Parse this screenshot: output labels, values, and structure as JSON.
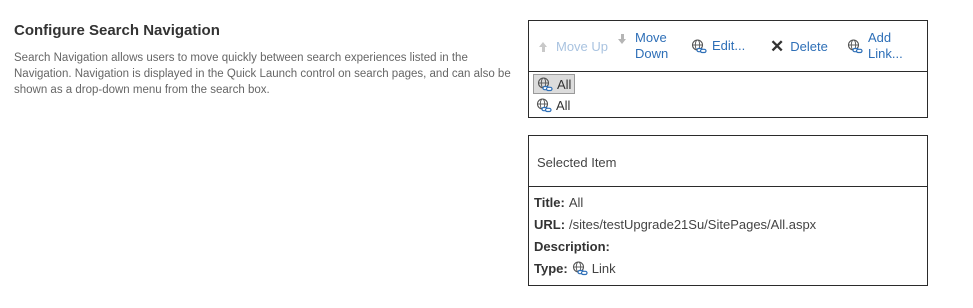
{
  "section": {
    "title": "Configure Search Navigation",
    "description": "Search Navigation allows users to move quickly between search experiences listed in the Navigation. Navigation is displayed in the Quick Launch control on search pages, and can also be shown as a drop-down menu from the search box."
  },
  "toolbar": {
    "move_up": "Move Up",
    "move_down_line1": "Move",
    "move_down_line2": "Down",
    "edit": "Edit...",
    "delete": "Delete",
    "add_link_line1": "Add",
    "add_link_line2": "Link..."
  },
  "tree": {
    "items": [
      {
        "label": "All",
        "selected": true
      },
      {
        "label": "All",
        "selected": false
      }
    ]
  },
  "selected_item": {
    "header": "Selected Item",
    "title_key": "Title:",
    "title_value": "All",
    "url_key": "URL:",
    "url_value": "/sites/testUpgrade21Su/SitePages/All.aspx",
    "description_key": "Description:",
    "description_value": "",
    "type_key": "Type:",
    "type_value": "Link"
  },
  "icons": {
    "move_up": "arrow-up-icon",
    "move_down": "arrow-down-icon",
    "edit": "link-edit-icon",
    "delete": "close-icon",
    "add_link": "add-link-icon",
    "node": "link-node-icon"
  },
  "colors": {
    "link": "#2e6fb7",
    "disabled": "#a9c3e0",
    "border": "#2b2b2b",
    "selected_bg": "#dcdcdc"
  }
}
